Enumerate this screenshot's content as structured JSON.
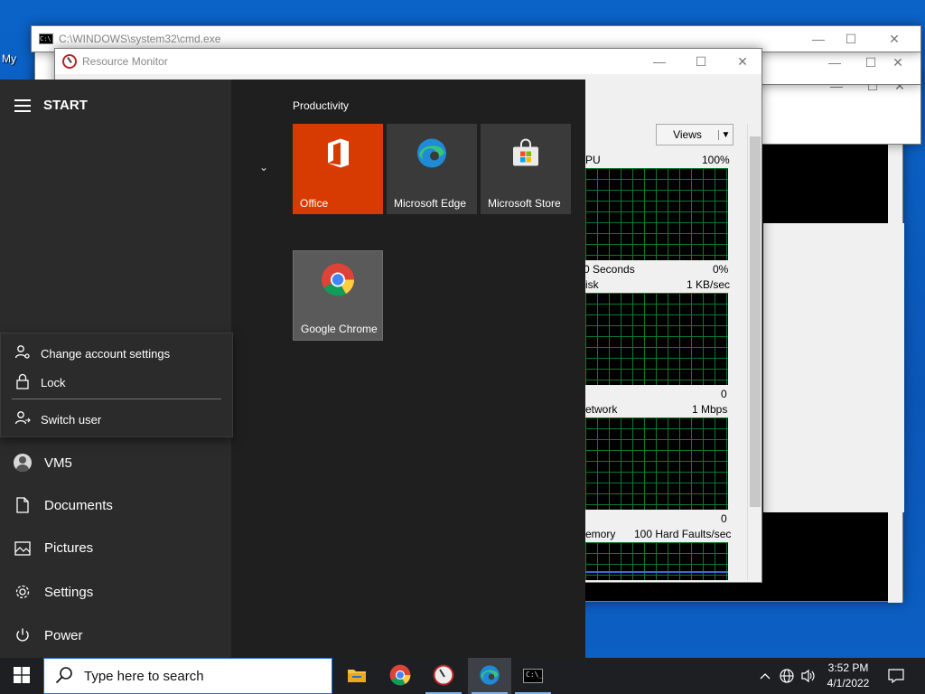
{
  "desktop": {
    "icon_label": "My"
  },
  "windows": {
    "cmd": {
      "title": "C:\\WINDOWS\\system32\\cmd.exe"
    },
    "resource_monitor": {
      "title": "Resource Monitor",
      "views_label": "Views",
      "graphs": [
        {
          "name": "CPU",
          "left_label": "PU",
          "right_label": "100%",
          "bottom_left": "0 Seconds",
          "bottom_right": "0%"
        },
        {
          "name": "Disk",
          "left_label": "isk",
          "right_label": "1 KB/sec",
          "bottom_right": "0"
        },
        {
          "name": "Network",
          "left_label": "etwork",
          "right_label": "1 Mbps",
          "bottom_right": "0"
        },
        {
          "name": "Memory",
          "left_label": "emory",
          "right_label": "100 Hard Faults/sec"
        }
      ]
    }
  },
  "start_menu": {
    "header": "START",
    "account_flyout": [
      {
        "label": "Change account settings",
        "icon": "person-gear-icon"
      },
      {
        "label": "Lock",
        "icon": "lock-icon"
      },
      {
        "label": "Switch user",
        "icon": "switch-user-icon"
      }
    ],
    "nav": [
      {
        "label": "VM5",
        "icon": "avatar"
      },
      {
        "label": "Documents",
        "icon": "document-icon"
      },
      {
        "label": "Pictures",
        "icon": "pictures-icon"
      },
      {
        "label": "Settings",
        "icon": "gear-icon"
      },
      {
        "label": "Power",
        "icon": "power-icon"
      }
    ],
    "group_title": "Productivity",
    "tiles": [
      {
        "label": "Office",
        "color": "#d83b01"
      },
      {
        "label": "Microsoft Edge",
        "color": "#3a3a3a"
      },
      {
        "label": "Microsoft Store",
        "color": "#3a3a3a"
      },
      {
        "label": "Google Chrome",
        "color": "#5a5a5a"
      }
    ]
  },
  "taskbar": {
    "search_placeholder": "Type here to search",
    "apps": [
      "file-explorer-icon",
      "chrome-icon",
      "resource-monitor-icon",
      "edge-icon",
      "cmd-icon"
    ],
    "clock_time": "3:52 PM",
    "clock_date": "4/1/2022"
  }
}
